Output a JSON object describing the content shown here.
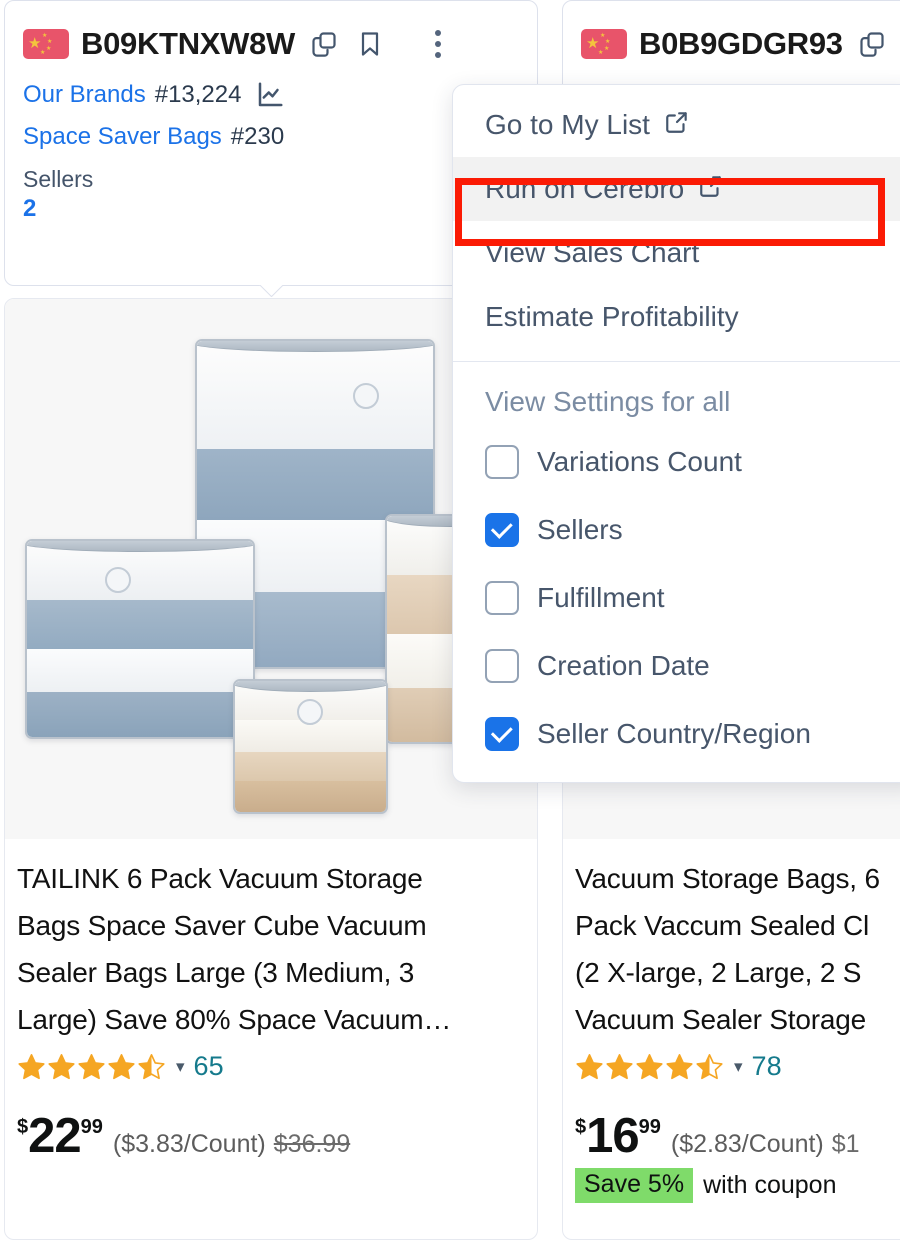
{
  "colors": {
    "link": "#1b72e8",
    "accent_checkbox": "#1a73e8",
    "highlight_outline": "#fb1b05",
    "coupon_green": "#7fdb6a",
    "star_orange": "#f5a623",
    "review_teal": "#157a8c"
  },
  "cards": [
    {
      "flag_icon": "china-flag-icon",
      "asin": "B09KTNXW8W",
      "copy_icon": "copy-icon",
      "bookmark_icon": "bookmark-icon",
      "more_icon": "more-vertical-icon",
      "brand_label": "Our Brands",
      "brand_rank": "#13,224",
      "chart_icon": "line-chart-icon",
      "category_label": "Space Saver Bags",
      "category_rank": "#230",
      "sellers_label": "Sellers",
      "sellers_value": "2",
      "title": "TAILINK 6 Pack Vacuum Storage\nBags Space Saver Cube Vacuum\nSealer Bags Large (3 Medium, 3\nLarge) Save 80% Space Vacuum…",
      "rating": 4.5,
      "review_count": "65",
      "currency": "$",
      "price_whole": "22",
      "price_frac": "99",
      "unit_price": "($3.83/Count)",
      "list_price": "$36.99",
      "coupon_badge": "",
      "coupon_text": ""
    },
    {
      "flag_icon": "china-flag-icon",
      "asin": "B0B9GDGR93",
      "copy_icon": "copy-icon",
      "bookmark_icon": "bookmark-icon",
      "more_icon": "more-vertical-icon",
      "brand_label": "",
      "brand_rank": "",
      "chart_icon": "line-chart-icon",
      "category_label": "",
      "category_rank": "",
      "sellers_label": "",
      "sellers_value": "",
      "title": "Vacuum Storage Bags, 6\nPack Vaccum Sealed Cl\n(2 X-large, 2 Large, 2 S\nVacuum Sealer Storage",
      "rating": 4.5,
      "review_count": "78",
      "currency": "$",
      "price_whole": "16",
      "price_frac": "99",
      "unit_price": "($2.83/Count)",
      "list_price": "$1",
      "coupon_badge": "Save 5%",
      "coupon_text": "with coupon"
    }
  ],
  "menu": {
    "items": [
      {
        "label": "Go to My List",
        "icon": "external-link-icon",
        "has_icon": true,
        "highlighted": false
      },
      {
        "label": "Run on Cerebro",
        "icon": "external-link-icon",
        "has_icon": true,
        "highlighted": true
      },
      {
        "label": "View Sales Chart",
        "icon": "",
        "has_icon": false,
        "highlighted": false
      },
      {
        "label": "Estimate Profitability",
        "icon": "",
        "has_icon": false,
        "highlighted": false
      }
    ],
    "settings_heading": "View Settings for all",
    "checkboxes": [
      {
        "label": "Variations Count",
        "checked": false
      },
      {
        "label": "Sellers",
        "checked": true
      },
      {
        "label": "Fulfillment",
        "checked": false
      },
      {
        "label": "Creation Date",
        "checked": false
      },
      {
        "label": "Seller Country/Region",
        "checked": true
      }
    ]
  }
}
